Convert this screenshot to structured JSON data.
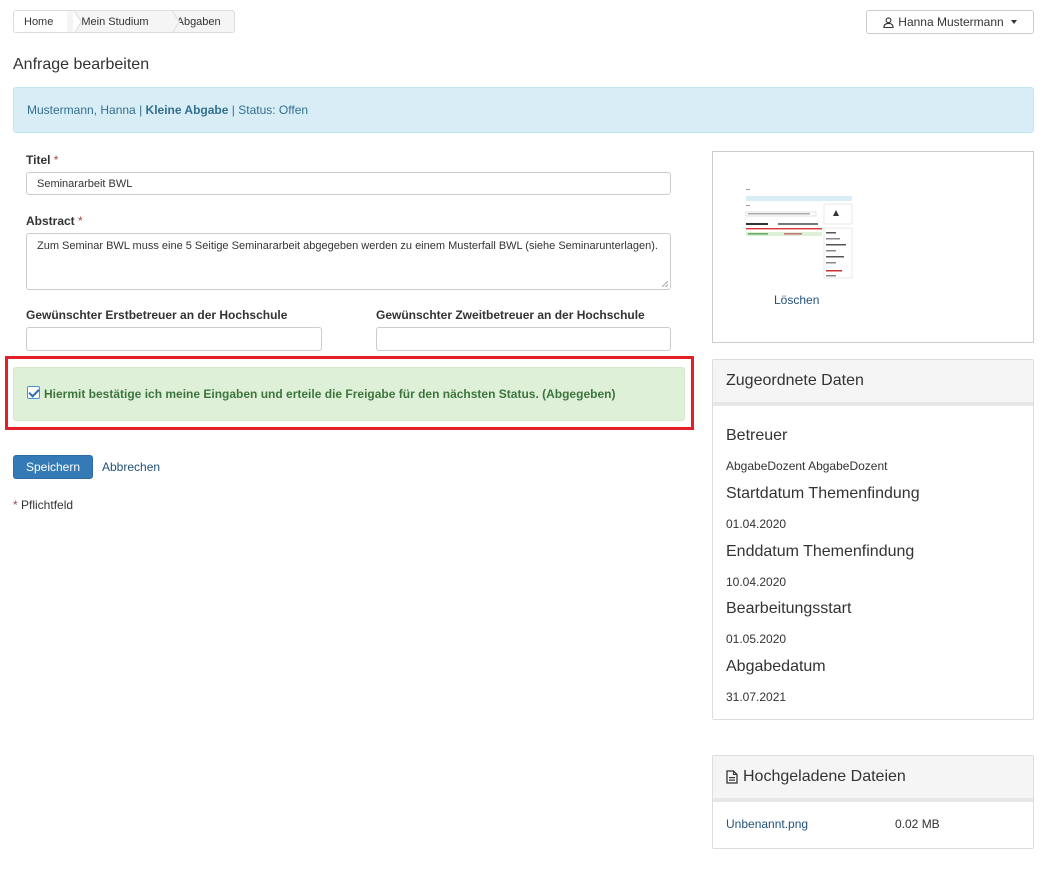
{
  "breadcrumb": {
    "items": [
      "Home",
      "Mein Studium",
      "Abgaben"
    ]
  },
  "user": {
    "name": "Hanna Mustermann"
  },
  "page": {
    "title": "Anfrage bearbeiten"
  },
  "info": {
    "name": "Mustermann, Hanna",
    "sep1": " | ",
    "assignment": "Kleine Abgabe",
    "sep2": " | ",
    "status": "Status: Offen"
  },
  "form": {
    "title_label": "Titel",
    "title_value": "Seminararbeit BWL",
    "abstract_label": "Abstract",
    "abstract_value": "Zum Seminar BWL muss eine 5 Seitige Seminararbeit abgegeben werden zu einem Musterfall BWL (siehe Seminarunterlagen).",
    "first_supervisor_label": "Gewünschter Erstbetreuer an der Hochschule",
    "first_supervisor_value": "",
    "second_supervisor_label": "Gewünschter Zweitbetreuer an der Hochschule",
    "second_supervisor_value": "",
    "required_marker": "*",
    "confirm_text": "Hiermit bestätige ich meine Eingaben und erteile die Freigabe für den nächsten Status. (Abgegeben)",
    "confirm_checked": true,
    "save_label": "Speichern",
    "cancel_label": "Abbrechen",
    "required_note": "Pflichtfeld"
  },
  "preview": {
    "delete_label": "Löschen"
  },
  "assigned": {
    "heading": "Zugeordnete Daten",
    "items": [
      {
        "label": "Betreuer",
        "value": "AbgabeDozent AbgabeDozent"
      },
      {
        "label": "Startdatum Themenfindung",
        "value": "01.04.2020"
      },
      {
        "label": "Enddatum Themenfindung",
        "value": "10.04.2020"
      },
      {
        "label": "Bearbeitungsstart",
        "value": "01.05.2020"
      },
      {
        "label": "Abgabedatum",
        "value": "31.07.2021"
      }
    ]
  },
  "files": {
    "heading": "Hochgeladene Dateien",
    "items": [
      {
        "name": "Unbenannt.png",
        "size": "0.02 MB"
      }
    ]
  },
  "colors": {
    "primary": "#337ab7",
    "info_bg": "#d9edf7",
    "success_bg": "#dff0d8",
    "highlight": "#e3202a"
  }
}
